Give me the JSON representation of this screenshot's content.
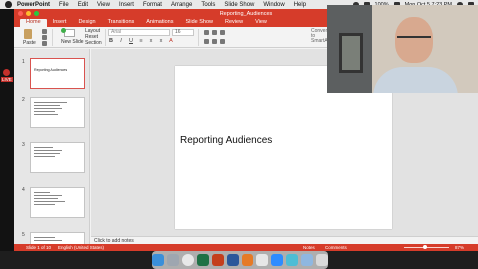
{
  "menubar": {
    "app_name": "PowerPoint",
    "items": [
      "File",
      "Edit",
      "View",
      "Insert",
      "Format",
      "Arrange",
      "Tools",
      "Slide Show",
      "Window",
      "Help"
    ],
    "battery": "100%",
    "clock": "Mon Oct 5  7:23 PM"
  },
  "window": {
    "title": "Reporting_Audiences"
  },
  "ribbon": {
    "tabs": [
      "Home",
      "Insert",
      "Design",
      "Transitions",
      "Animations",
      "Slide Show",
      "Review",
      "View"
    ],
    "active_tab": "Home",
    "paste_label": "Paste",
    "new_slide_label": "New Slide",
    "layout_label": "Layout",
    "reset_label": "Reset",
    "section_label": "Section",
    "font_name": "Arial",
    "font_size": "16",
    "convert_label": "Convert to SmartArt"
  },
  "thumbnails": [
    {
      "num": "1",
      "title": "Reporting Audiences",
      "selected": true
    },
    {
      "num": "2",
      "title": "",
      "selected": false
    },
    {
      "num": "3",
      "title": "",
      "selected": false
    },
    {
      "num": "4",
      "title": "",
      "selected": false
    },
    {
      "num": "5",
      "title": "",
      "selected": false
    }
  ],
  "slide": {
    "title": "Reporting Audiences"
  },
  "notes": {
    "placeholder": "Click to add notes"
  },
  "status": {
    "slide_indicator": "Slide 1 of 10",
    "language": "English (United States)",
    "notes_label": "Notes",
    "comments_label": "Comments",
    "zoom": "87%",
    "zoom_fraction": 0.47
  },
  "left_strip": {
    "live_label": "LIVE"
  },
  "dock": {
    "apps": [
      "finder-icon",
      "launchpad-icon",
      "chrome-icon",
      "excel-icon",
      "powerpoint-icon",
      "word-icon",
      "books-icon",
      "acrobat-icon",
      "zoom-icon",
      "edge-icon",
      "preview-icon",
      "trash-icon"
    ]
  }
}
